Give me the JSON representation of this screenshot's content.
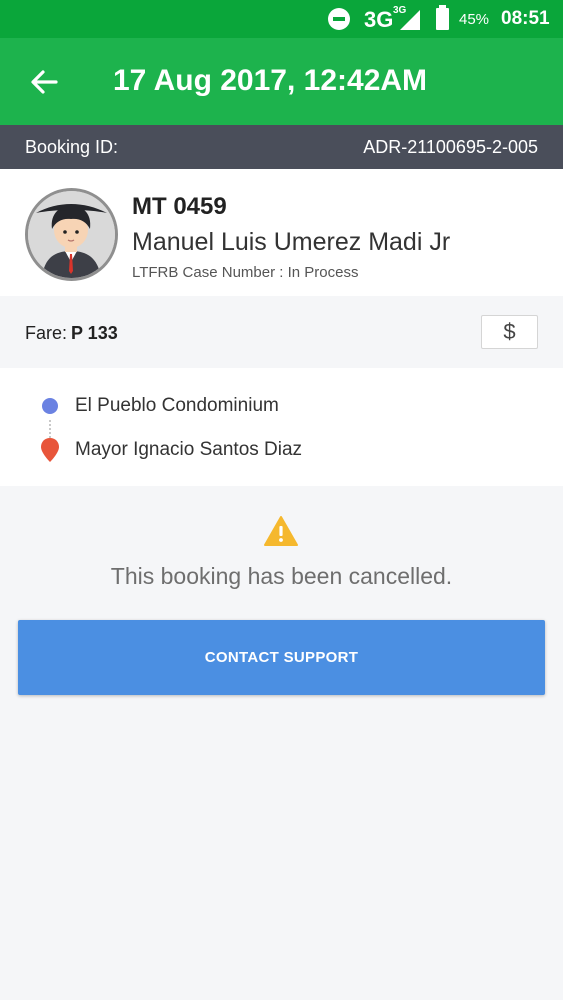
{
  "status_bar": {
    "network": "3G",
    "network_small": "3G",
    "battery_percent": "45%",
    "time": "08:51"
  },
  "header": {
    "title": "17 Aug 2017, 12:42AM"
  },
  "booking": {
    "id_label": "Booking ID:",
    "id_value": "ADR-21100695-2-005"
  },
  "driver": {
    "plate": "MT 0459",
    "name": "Manuel Luis Umerez Madi Jr",
    "case_number": "LTFRB Case Number : In Process"
  },
  "fare": {
    "label": "Fare:",
    "value": "P 133",
    "button_symbol": "$"
  },
  "route": {
    "pickup": "El Pueblo Condominium",
    "dropoff": "Mayor Ignacio Santos Diaz"
  },
  "notice": {
    "message": "This booking has been cancelled."
  },
  "actions": {
    "contact_support": "CONTACT SUPPORT"
  },
  "colors": {
    "status_bar": "#0aa63a",
    "app_bar": "#1db34d",
    "booking_bar": "#4a4e5a",
    "primary_button": "#4b8fe2",
    "pickup_dot": "#6b82e2",
    "dropoff_pin": "#e8553a",
    "warning": "#f5b82e"
  },
  "icons": {
    "back": "arrow-left-icon",
    "fare_button": "dollar-icon",
    "pickup": "pickup-dot-icon",
    "dropoff": "map-pin-icon",
    "warning": "warning-triangle-icon"
  }
}
